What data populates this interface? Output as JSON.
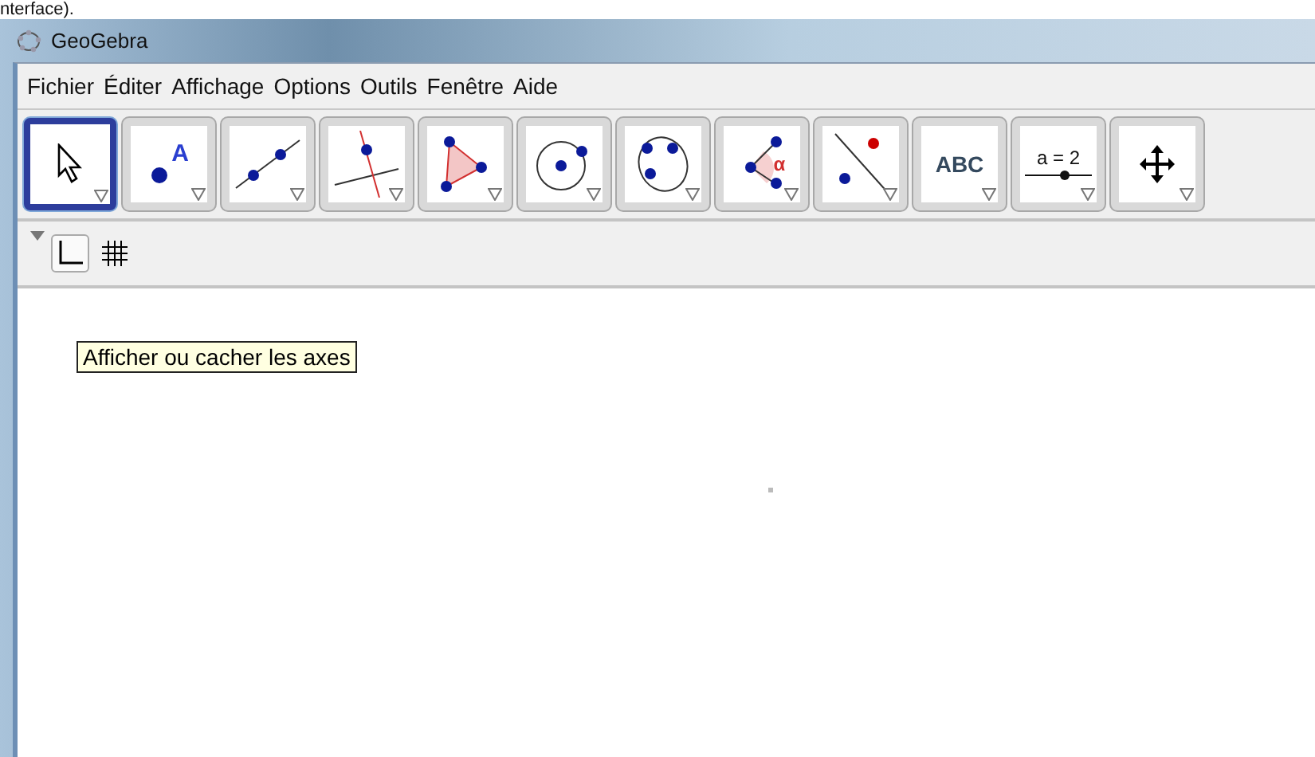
{
  "caption": "nterface).",
  "window": {
    "title": "GeoGebra"
  },
  "menu": [
    "Fichier",
    "Éditer",
    "Affichage",
    "Options",
    "Outils",
    "Fenêtre",
    "Aide"
  ],
  "tools": [
    {
      "kind": "pointer",
      "selected": true
    },
    {
      "kind": "point",
      "label": "A",
      "selected": false
    },
    {
      "kind": "line",
      "selected": false
    },
    {
      "kind": "perpendicular",
      "selected": false
    },
    {
      "kind": "polygon",
      "selected": false
    },
    {
      "kind": "circle",
      "selected": false
    },
    {
      "kind": "conic",
      "selected": false
    },
    {
      "kind": "angle",
      "label": "α",
      "selected": false
    },
    {
      "kind": "reflect",
      "selected": false
    },
    {
      "kind": "text",
      "label": "ABC",
      "selected": false
    },
    {
      "kind": "slider",
      "label": "a = 2",
      "selected": false
    },
    {
      "kind": "move",
      "selected": false
    }
  ],
  "style_bar": [
    {
      "kind": "axes",
      "selected": true
    },
    {
      "kind": "grid",
      "selected": false
    }
  ],
  "tooltip": "Afficher ou cacher les axes"
}
